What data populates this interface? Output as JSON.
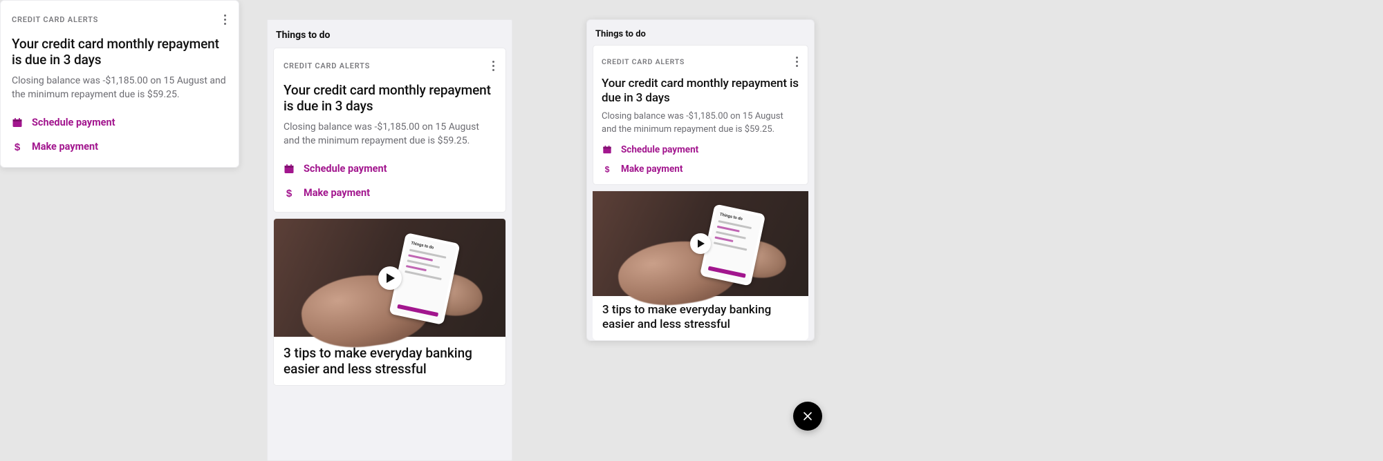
{
  "colors": {
    "accent": "#a2168e"
  },
  "things_to_do_heading": "Things to do",
  "alert_card": {
    "eyebrow": "CREDIT CARD ALERTS",
    "title": "Your credit card monthly repayment is due in 3 days",
    "body": "Closing balance was -$1,185.00 on 15 August and the minimum repayment due is $59.25.",
    "actions": {
      "schedule": "Schedule payment",
      "make": "Make payment"
    }
  },
  "tips_card": {
    "title": "3 tips to make everyday banking easier and less stressful",
    "phone_heading": "Things to do"
  },
  "icons": {
    "more": "more-vertical-icon",
    "calendar": "calendar-icon",
    "dollar": "dollar-icon",
    "play": "play-icon",
    "close": "close-icon"
  }
}
